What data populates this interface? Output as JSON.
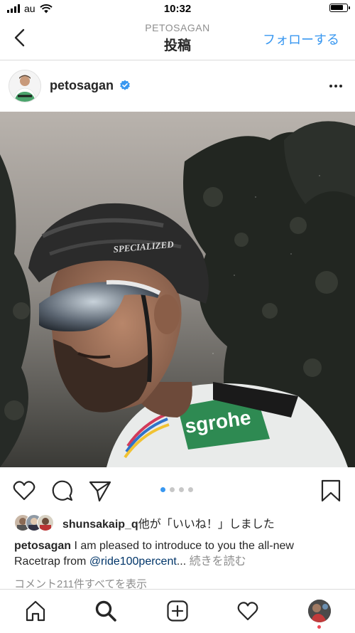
{
  "status_bar": {
    "carrier": "au",
    "time": "10:32",
    "battery_level": 0.85
  },
  "nav": {
    "subtitle": "PETOSAGAN",
    "title": "投稿",
    "follow_label": "フォローする",
    "back_icon": "chevron-left-icon"
  },
  "post": {
    "username": "petosagan",
    "verified": true,
    "more_icon": "ellipsis-icon",
    "image_count": 4,
    "active_image_index": 0
  },
  "actions": {
    "like_icon": "heart-icon",
    "comment_icon": "comment-icon",
    "share_icon": "paper-plane-icon",
    "save_icon": "bookmark-icon"
  },
  "likes": {
    "user": "shunsakaip_q",
    "suffix": "他が「いいね！」しました"
  },
  "caption": {
    "username": "petosagan",
    "text": " I am pleased to introduce to you the all-new Racetrap from ",
    "mention": "@ride100percent",
    "ellipsis": "...",
    "more_label": " 続きを読む"
  },
  "comments_link": "コメント211件すべてを表示",
  "tab_bar": {
    "items": [
      "home-icon",
      "search-icon",
      "new-post-icon",
      "activity-heart-icon",
      "profile-avatar"
    ]
  },
  "colors": {
    "accent": "#3897f0",
    "text": "#262626",
    "muted": "#8e8e8e",
    "mention": "#003569",
    "notification": "#ed4956"
  }
}
